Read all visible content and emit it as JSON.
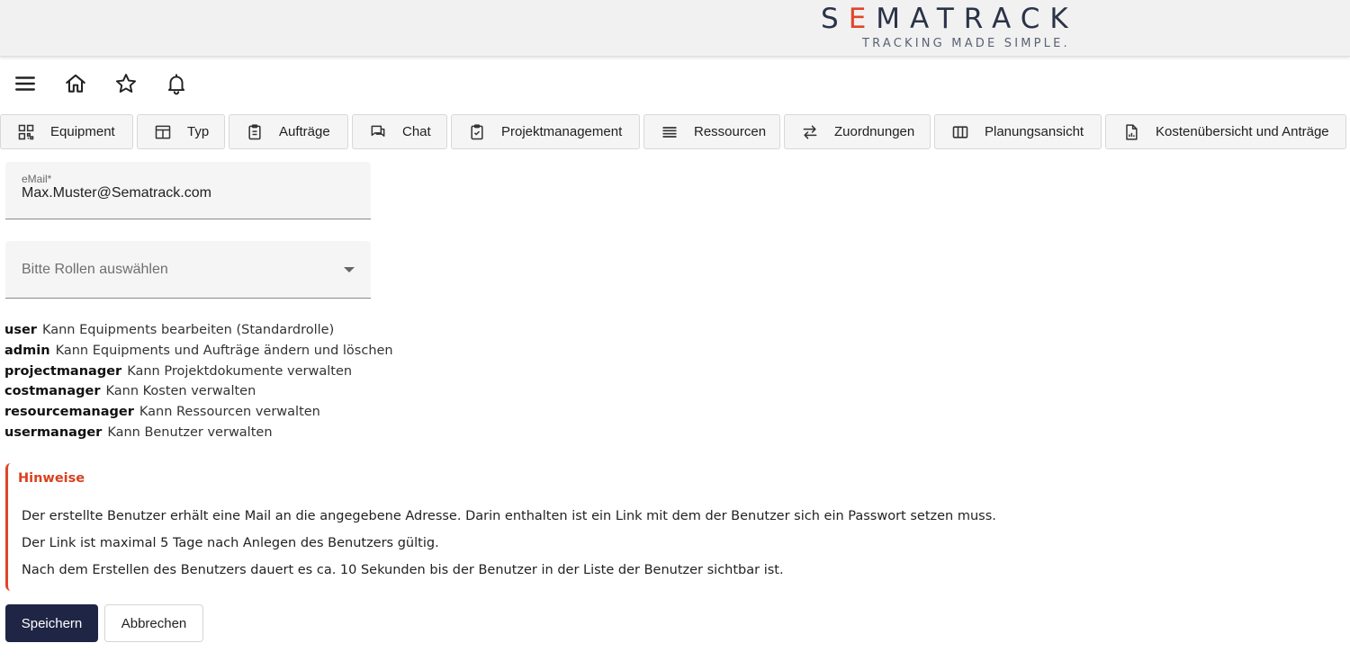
{
  "brand": {
    "logo_word_prefix": "S",
    "logo_word_accent": "E",
    "logo_word_suffix": "MATRACK",
    "tagline": "TRACKING MADE SIMPLE.",
    "accent_color": "#e0452a",
    "primary_color": "#1f2545"
  },
  "toolbar": {
    "icons": [
      "menu-icon",
      "home-icon",
      "star-icon",
      "bell-icon"
    ]
  },
  "nav": {
    "items": [
      {
        "label": "Equipment",
        "icon": "qr-code-icon"
      },
      {
        "label": "Typ",
        "icon": "layout-icon"
      },
      {
        "label": "Aufträge",
        "icon": "clipboard-icon"
      },
      {
        "label": "Chat",
        "icon": "chat-icon"
      },
      {
        "label": "Projektmanagement",
        "icon": "clipboard-check-icon"
      },
      {
        "label": "Ressourcen",
        "icon": "list-icon"
      },
      {
        "label": "Zuordnungen",
        "icon": "swap-icon"
      },
      {
        "label": "Planungsansicht",
        "icon": "columns-icon"
      },
      {
        "label": "Kostenübersicht und Anträge",
        "icon": "report-icon"
      }
    ]
  },
  "form": {
    "email_label": "eMail*",
    "email_value": "Max.Muster@Sematrack.com",
    "roles_placeholder": "Bitte Rollen auswählen"
  },
  "roles": [
    {
      "name": "user",
      "description": "Kann Equipments bearbeiten (Standardrolle)"
    },
    {
      "name": "admin",
      "description": "Kann Equipments und Aufträge ändern und löschen"
    },
    {
      "name": "projectmanager",
      "description": "Kann Projektdokumente verwalten"
    },
    {
      "name": "costmanager",
      "description": "Kann Kosten verwalten"
    },
    {
      "name": "resourcemanager",
      "description": "Kann Ressourcen verwalten"
    },
    {
      "name": "usermanager",
      "description": "Kann Benutzer verwalten"
    }
  ],
  "notice": {
    "title": "Hinweise",
    "lines": [
      "Der erstellte Benutzer erhält eine Mail an die angegebene Adresse. Darin enthalten ist ein Link mit dem der Benutzer sich ein Passwort setzen muss.",
      "Der Link ist maximal 5 Tage nach Anlegen des Benutzers gültig.",
      "Nach dem Erstellen des Benutzers dauert es ca. 10 Sekunden bis der Benutzer in der Liste der Benutzer sichtbar ist."
    ]
  },
  "actions": {
    "save_label": "Speichern",
    "cancel_label": "Abbrechen"
  }
}
